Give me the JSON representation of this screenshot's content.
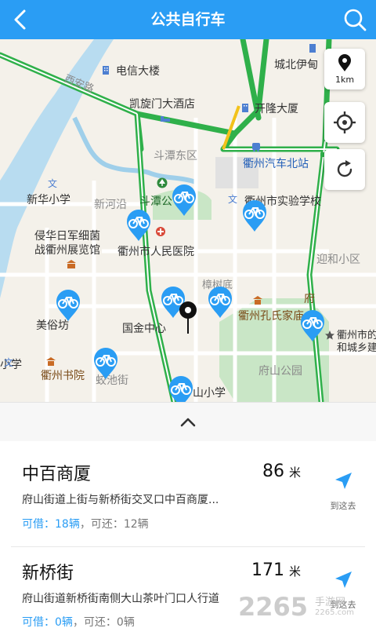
{
  "header": {
    "title": "公共自行车",
    "back_icon": "back-arrow-icon",
    "search_icon": "search-icon",
    "bg_color": "#2a9df4"
  },
  "map": {
    "scale_label": "1km",
    "labels": {
      "dianxin": "电信大楼",
      "chengbei": "城北伊甸",
      "xianzhi": "西安路",
      "kaixuanmen": "凯旋门大酒店",
      "kailong": "开隆大厦",
      "doutan_east": "斗潭东区",
      "bus_north": "衢州汽车北站",
      "xinhua": "新华小学",
      "xinhe": "新河沿",
      "doutan": "斗潭公",
      "shiyan": "衢州市实验学校",
      "qinhua1": "侵华日军细菌",
      "qinhua2": "战衢州展览馆",
      "hospital": "衢州市人民医院",
      "yinghe": "迎和小区",
      "zhangshu": "樟树底",
      "kongshi": "衢州孔氏家庙",
      "meisu": "美俗坊",
      "guojin": "国金中心",
      "quzhou_city1": "衢州市的",
      "quzhou_city2": "和城乡建",
      "xue": "小学",
      "shuyuan": "衢州书院",
      "jiaochi": "蛟池街",
      "fushan_park": "府山公园",
      "shan_school": "山小学",
      "fu": "府"
    }
  },
  "stations": [
    {
      "name": "中百商厦",
      "distance": "86",
      "unit": "米",
      "address": "府山街道上街与新桥街交叉口中百商厦...",
      "borrow_label": "可借：18辆",
      "return_label": "可还：12辆",
      "goto_label": "到这去"
    },
    {
      "name": "新桥街",
      "distance": "171",
      "unit": "米",
      "address": "府山街道新桥街南侧大山茶叶门口人行道",
      "borrow_label": "可借：0辆",
      "return_label": "可还：0辆",
      "goto_label": "到这去"
    }
  ],
  "watermark": {
    "number": "2265",
    "text": "手游网",
    "url": "2265.com"
  },
  "colors": {
    "accent": "#2a9df4",
    "road_green": "#2fb04a",
    "water": "#b8dcf0",
    "park": "#c9e6c6"
  }
}
